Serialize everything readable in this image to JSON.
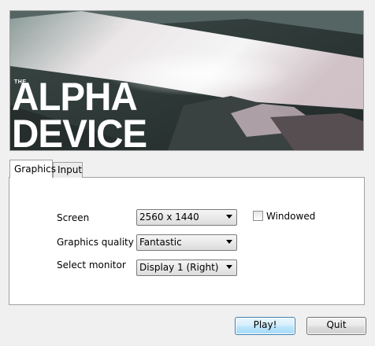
{
  "banner": {
    "title_small": "THE",
    "title_line1": "ALPHA",
    "title_line2": "DEVICE"
  },
  "tabs": [
    {
      "label": "Graphics",
      "active": true
    },
    {
      "label": "Input",
      "active": false
    }
  ],
  "settings": {
    "screen_label": "Screen",
    "screen_value": "2560 x 1440",
    "quality_label": "Graphics quality",
    "quality_value": "Fantastic",
    "monitor_label": "Select monitor",
    "monitor_value": "Display 1 (Right)",
    "windowed_label": "Windowed",
    "windowed_checked": false
  },
  "buttons": {
    "play": "Play!",
    "quit": "Quit"
  },
  "colors": {
    "background": "#f0f0f0",
    "panel": "#ffffff",
    "play_border": "#3c7fb1"
  }
}
